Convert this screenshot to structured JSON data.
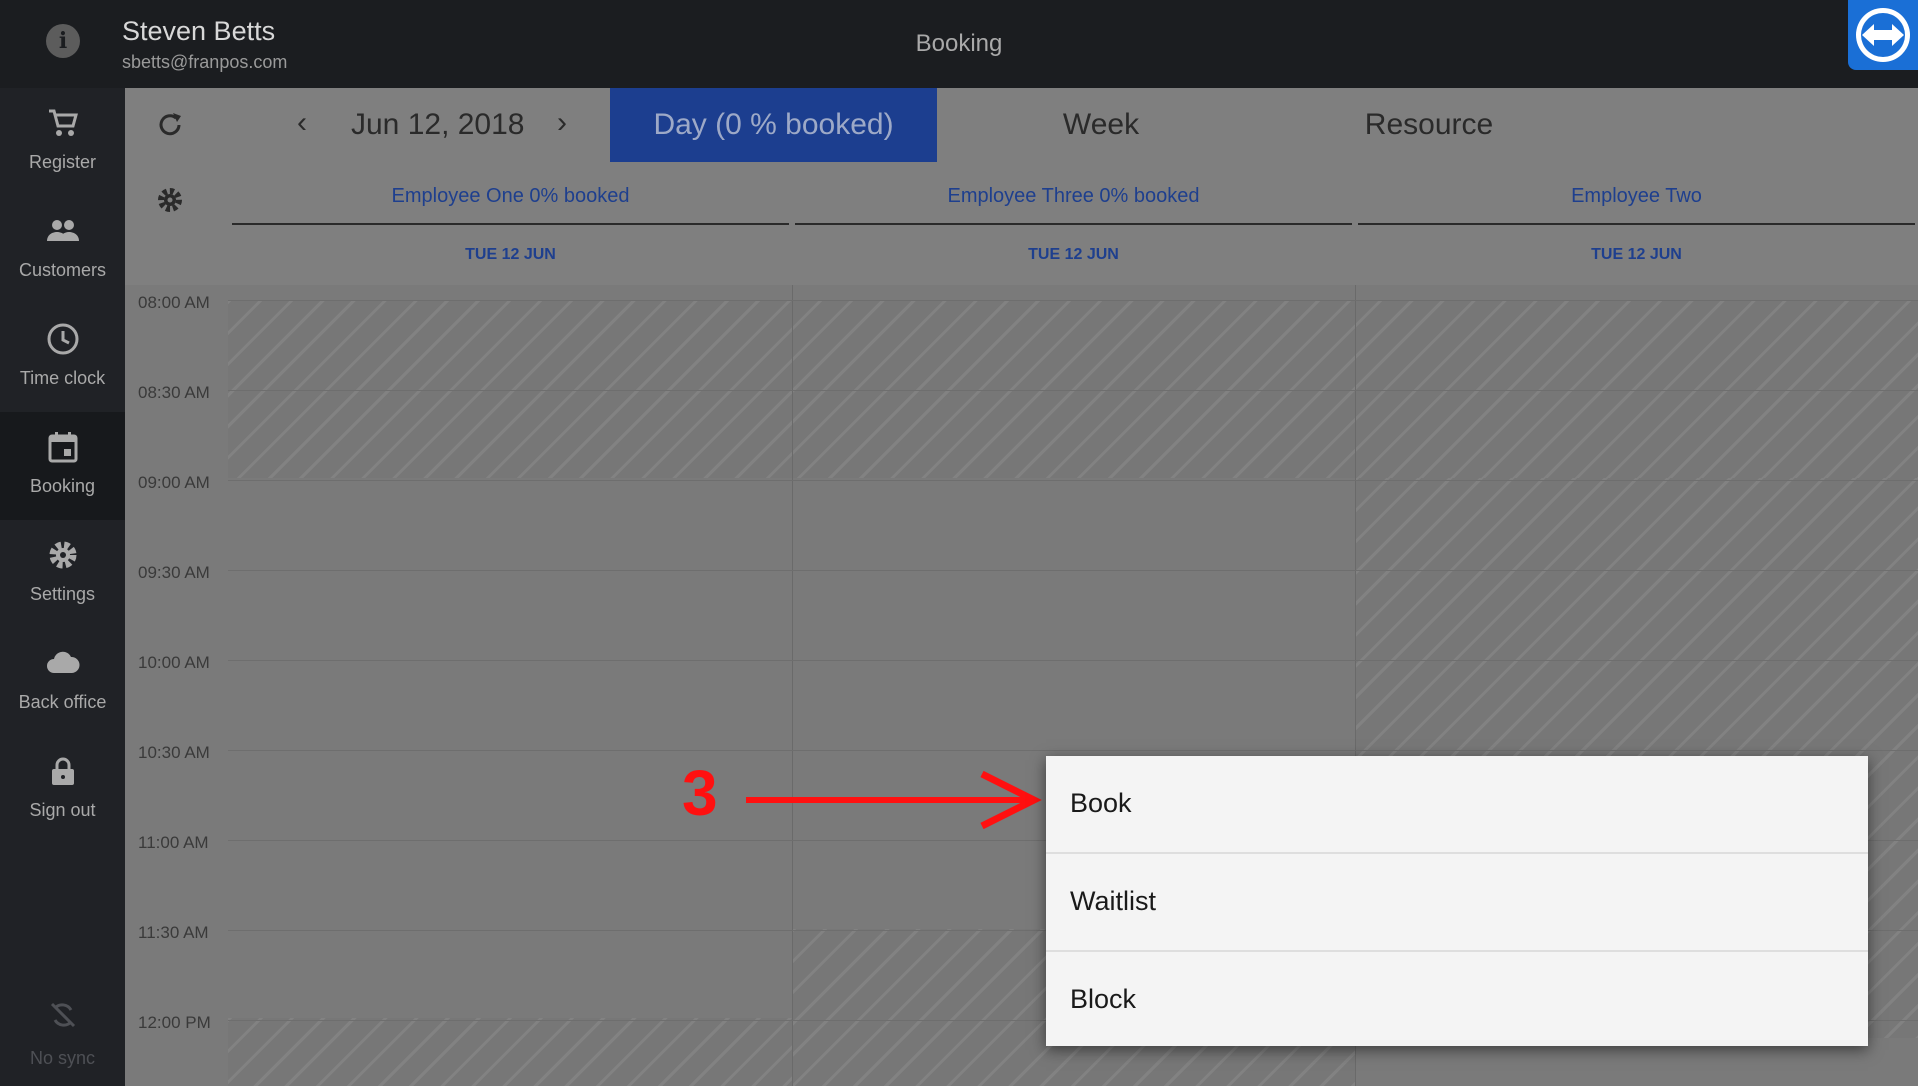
{
  "header": {
    "user_name": "Steven Betts",
    "user_email": "sbetts@franpos.com",
    "title": "Booking"
  },
  "sidebar": {
    "items": [
      {
        "label": "Register",
        "icon": "cart-icon"
      },
      {
        "label": "Customers",
        "icon": "people-icon"
      },
      {
        "label": "Time clock",
        "icon": "clock-icon"
      },
      {
        "label": "Booking",
        "icon": "calendar-icon",
        "active": true
      },
      {
        "label": "Settings",
        "icon": "gear-icon"
      },
      {
        "label": "Back office",
        "icon": "cloud-icon"
      },
      {
        "label": "Sign out",
        "icon": "lock-icon"
      }
    ],
    "sync_label": "No sync"
  },
  "toolbar": {
    "date": "Jun 12, 2018",
    "prev": "‹",
    "next": "›",
    "tabs": [
      "Day (0 % booked)",
      "Week",
      "Resource"
    ],
    "active_tab": 0
  },
  "employees": [
    {
      "name": "Employee One 0% booked",
      "date": "TUE 12 JUN"
    },
    {
      "name": "Employee Three 0% booked",
      "date": "TUE 12 JUN"
    },
    {
      "name": "Employee Two",
      "date": "TUE 12 JUN"
    }
  ],
  "times": [
    "08:00 AM",
    "08:30 AM",
    "09:00 AM",
    "09:30 AM",
    "10:00 AM",
    "10:30 AM",
    "11:00 AM",
    "11:30 AM",
    "12:00 PM"
  ],
  "menu": {
    "items": [
      "Book",
      "Waitlist",
      "Block"
    ]
  },
  "annotation": {
    "step": "3",
    "color": "#ff1010"
  },
  "colors": {
    "accent": "#1c3e8f",
    "link": "#1e3f8e"
  }
}
